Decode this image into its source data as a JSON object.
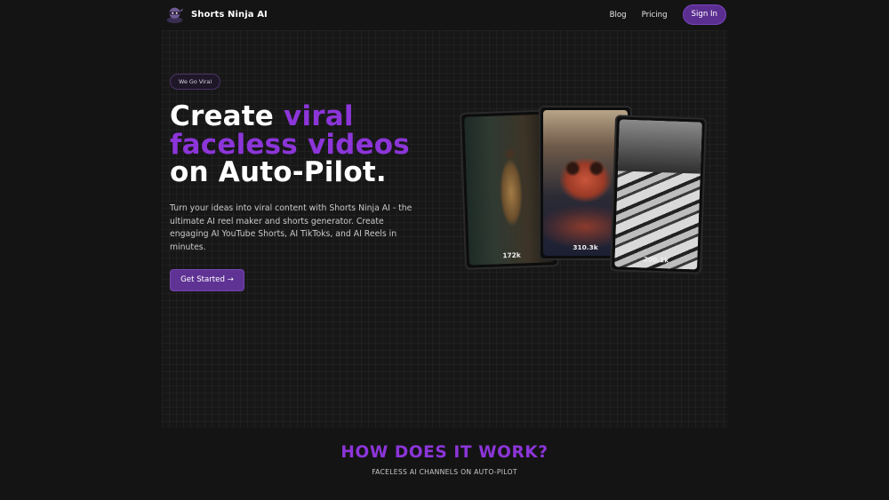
{
  "header": {
    "brand": "Shorts Ninja AI",
    "nav": {
      "blog": "Blog",
      "pricing": "Pricing",
      "signin": "Sign In"
    }
  },
  "hero": {
    "badge": "We Go Viral",
    "headline": {
      "line1_plain": "Create ",
      "line1_accent": "viral",
      "line2_accent": "faceless videos",
      "line3_plain": "on Auto-Pilot."
    },
    "description": "Turn your ideas into viral content with Shorts Ninja AI - the ultimate AI reel maker and shorts generator. Create engaging AI YouTube Shorts, AI TikToks, and AI Reels in minutes.",
    "cta": "Get Started →",
    "videos": [
      {
        "views": "172k"
      },
      {
        "views": "310.3k"
      },
      {
        "views": "200.1k"
      }
    ]
  },
  "how": {
    "title": "HOW DOES IT WORK?",
    "subtitle": "FACELESS AI CHANNELS ON AUTO-PILOT"
  },
  "colors": {
    "accent": "#8c35d9",
    "button": "#5f3394",
    "background": "#141414"
  },
  "icons": {
    "logo": "ninja-logo-icon"
  }
}
